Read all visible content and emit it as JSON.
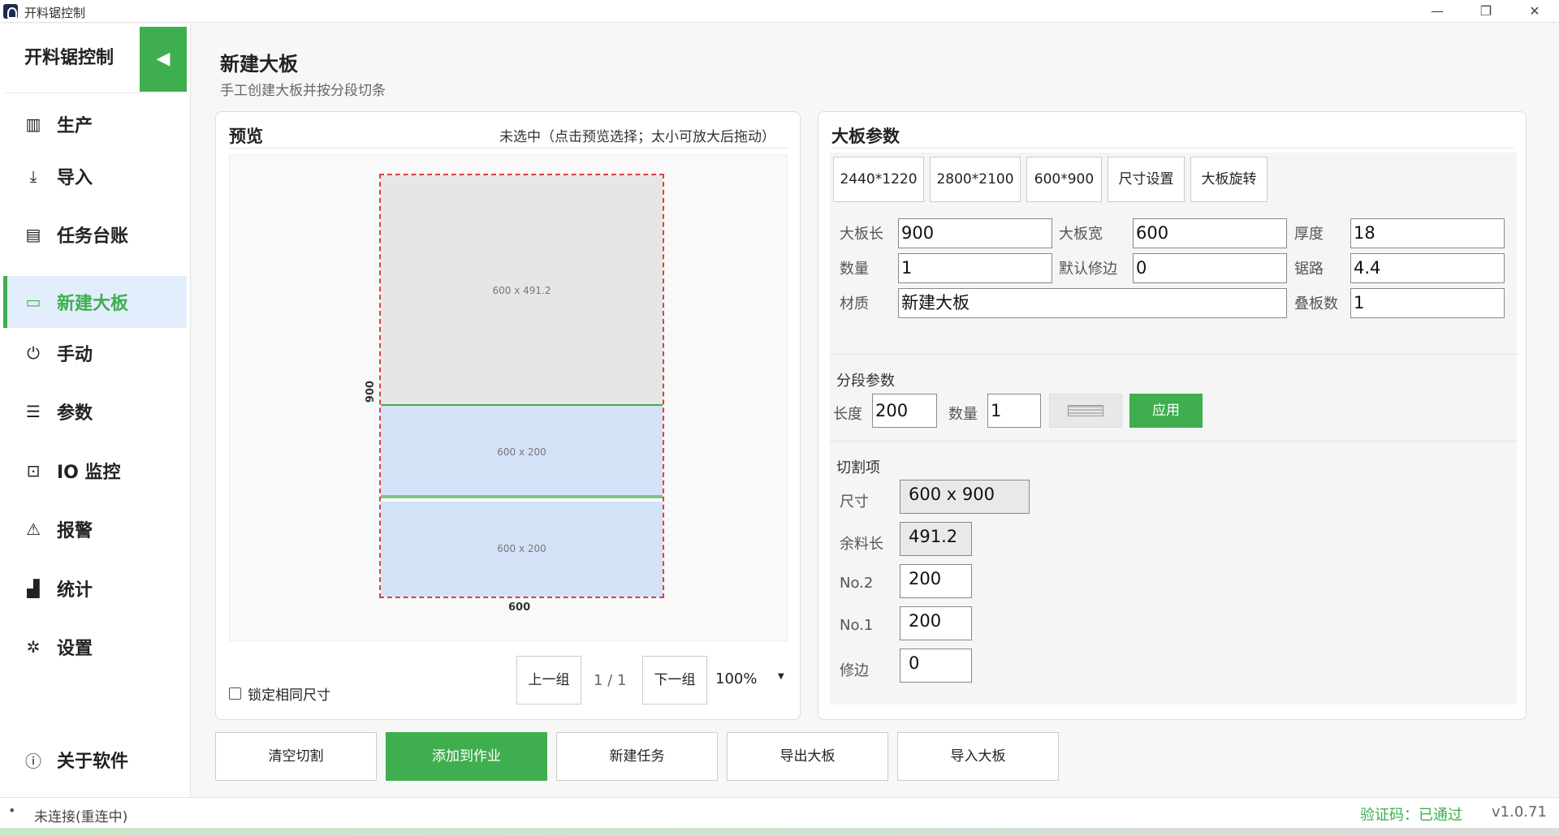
{
  "window": {
    "title": "开料锯控制",
    "minimize": "—",
    "maximize": "❐",
    "close": "✕"
  },
  "sidebar": {
    "brand": "开料锯控制",
    "collapse_icon": "◀",
    "items": [
      {
        "label": "生产",
        "icon": "▥"
      },
      {
        "label": "导入",
        "icon": "⤓"
      },
      {
        "label": "任务台账",
        "icon": "▤"
      },
      {
        "label": "新建大板",
        "icon": "▭"
      },
      {
        "label": "手动",
        "icon": "⏻"
      },
      {
        "label": "参数",
        "icon": "☰"
      },
      {
        "label": "IO 监控",
        "icon": "⊡"
      },
      {
        "label": "报警",
        "icon": "⚠"
      },
      {
        "label": "统计",
        "icon": "▟"
      },
      {
        "label": "设置",
        "icon": "✲"
      }
    ],
    "about": {
      "label": "关于软件",
      "icon": "ⓘ"
    }
  },
  "page": {
    "title": "新建大板",
    "subtitle": "手工创建大板并按分段切条"
  },
  "preview": {
    "title": "预览",
    "hint": "未选中（点击预览选择；太小可放大后拖动）",
    "board_width_label": "600",
    "board_length_label": "900",
    "segments": [
      "600 x 491.2",
      "600 x 200",
      "600 x 200"
    ],
    "lock_label": "锁定相同尺寸",
    "prev": "上一组",
    "page": "1 / 1",
    "next": "下一组",
    "zoom": "100%"
  },
  "params": {
    "title": "大板参数",
    "presets": [
      "2440*1220",
      "2800*2100",
      "600*900",
      "尺寸设置",
      "大板旋转"
    ],
    "fields": {
      "length_label": "大板长",
      "length": "900",
      "width_label": "大板宽",
      "width": "600",
      "thickness_label": "厚度",
      "thickness": "18",
      "qty_label": "数量",
      "qty": "1",
      "trim_label": "默认修边",
      "trim": "0",
      "kerf_label": "锯路",
      "kerf": "4.4",
      "material_label": "材质",
      "material": "新建大板",
      "stack_label": "叠板数",
      "stack": "1"
    },
    "segment": {
      "title": "分段参数",
      "length_label": "长度",
      "length": "200",
      "qty_label": "数量",
      "qty": "1",
      "apply": "应用"
    },
    "cuts": {
      "title": "切割项",
      "size_label": "尺寸",
      "size": "600 x 900",
      "rem_label": "余料长",
      "rem": "491.2",
      "no2_label": "No.2",
      "no2": "200",
      "no1_label": "No.1",
      "no1": "200",
      "trim_label": "修边",
      "trim": "0"
    }
  },
  "actions": [
    "清空切割",
    "添加到作业",
    "新建任务",
    "导出大板",
    "导入大板"
  ],
  "status": {
    "connection": "未连接(重连中)",
    "verify": "验证码：已通过",
    "version": "v1.0.71"
  },
  "colors": {
    "accent": "#3fae4f",
    "segment_fill": "#d3e2f7",
    "remnant_fill": "#e6e6e6",
    "board_border": "#e04040"
  }
}
